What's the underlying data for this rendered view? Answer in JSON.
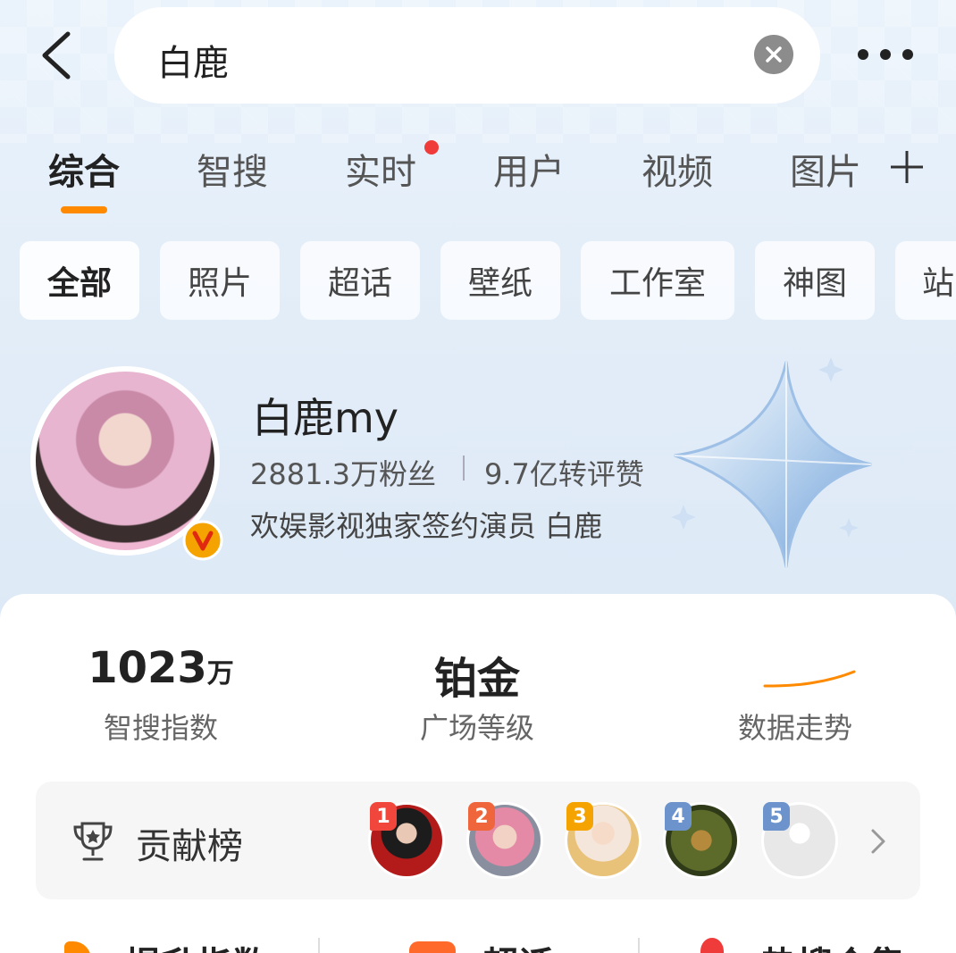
{
  "search": {
    "query": "白鹿"
  },
  "tabs": [
    {
      "label": "综合",
      "active": true
    },
    {
      "label": "智搜",
      "active": false
    },
    {
      "label": "实时",
      "active": false,
      "dot": true
    },
    {
      "label": "用户",
      "active": false
    },
    {
      "label": "视频",
      "active": false
    },
    {
      "label": "图片",
      "active": false
    }
  ],
  "chips": [
    "全部",
    "照片",
    "超话",
    "壁纸",
    "工作室",
    "神图",
    "站"
  ],
  "profile": {
    "name": "白鹿my",
    "fans": "2881.3万粉丝",
    "interactions": "9.7亿转评赞",
    "description": "欢娱影视独家签约演员 白鹿"
  },
  "stats": {
    "search_index_value": "1023",
    "search_index_unit": "万",
    "search_index_label": "智搜指数",
    "plaza_level_value": "铂金",
    "plaza_level_label": "广场等级",
    "trend_label": "数据走势"
  },
  "contribution": {
    "label": "贡献榜",
    "ranks": [
      "1",
      "2",
      "3",
      "4",
      "5"
    ]
  },
  "bottom": [
    "提升指数",
    "超话",
    "热搜合集"
  ],
  "colors": {
    "accent": "#ff8a00",
    "notify_dot": "#f03b3b",
    "verified": "#f5a300"
  }
}
